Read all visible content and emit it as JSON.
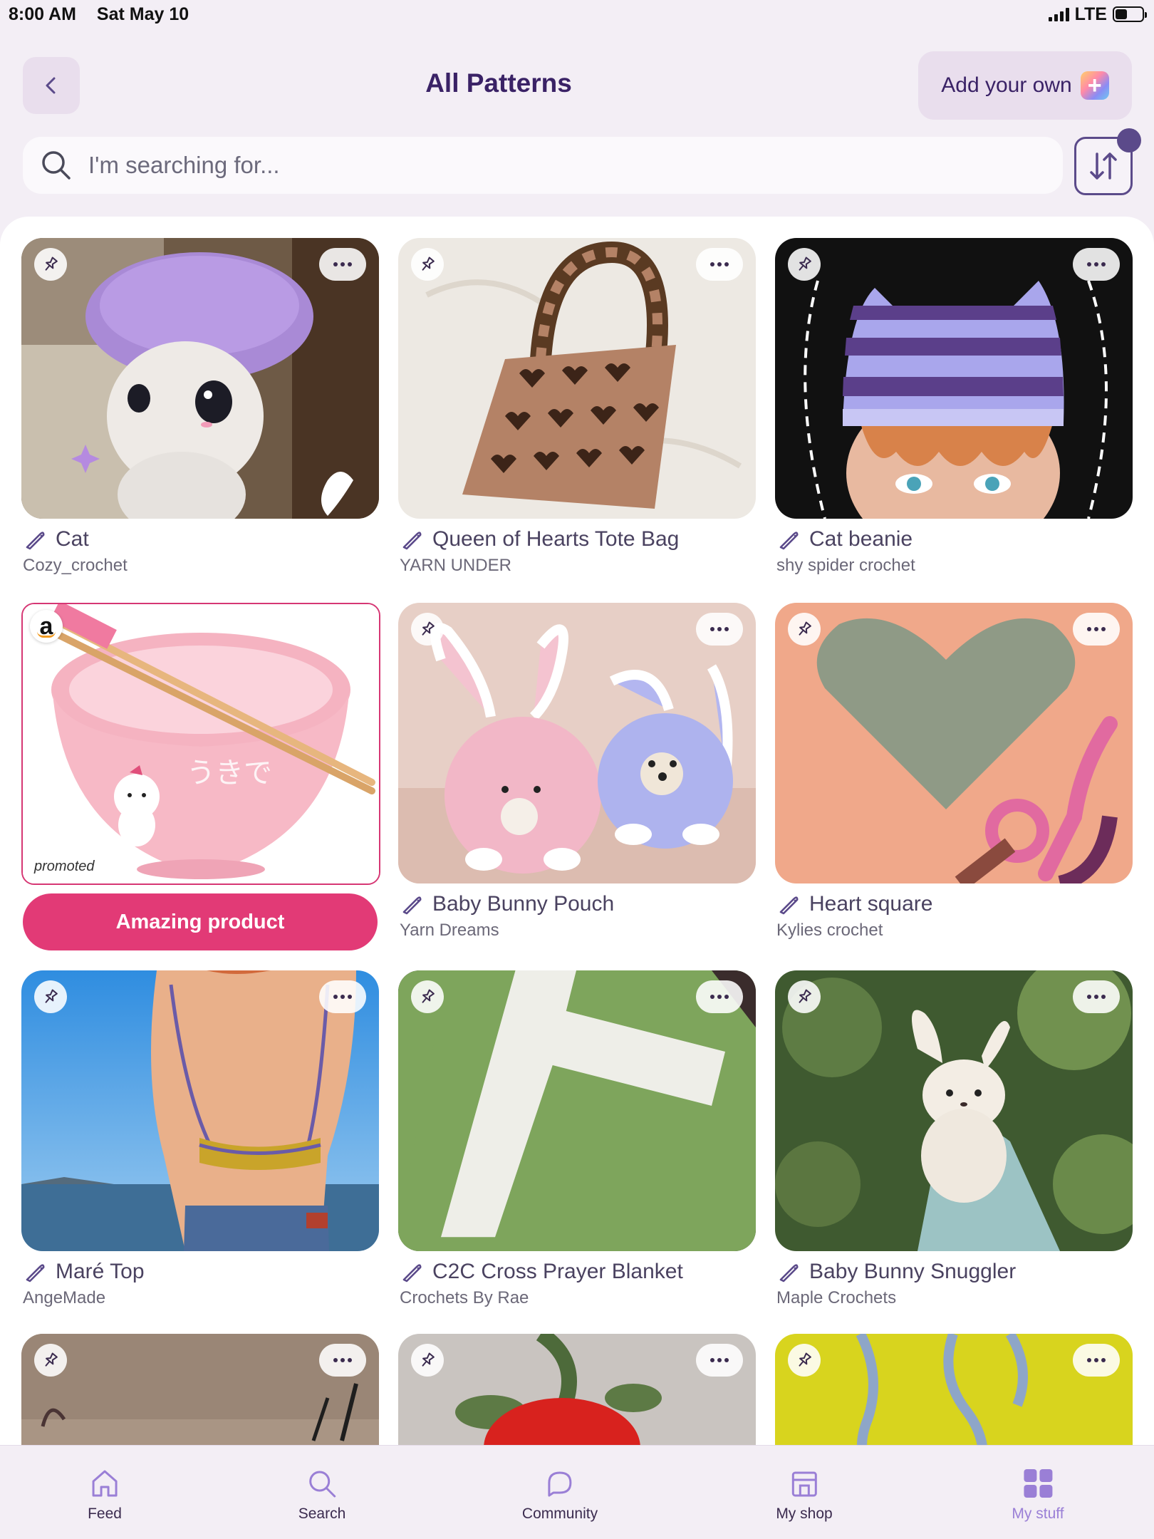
{
  "status_bar": {
    "time": "8:00 AM",
    "date": "Sat May 10",
    "network": "LTE"
  },
  "header": {
    "title": "All Patterns",
    "add_own_label": "Add your own"
  },
  "search": {
    "placeholder": "I'm searching for..."
  },
  "cards": [
    {
      "title": "Cat",
      "author": "Cozy_crochet"
    },
    {
      "title": "Queen of Hearts Tote Bag",
      "author": "YARN UNDER"
    },
    {
      "title": "Cat beanie",
      "author": "shy spider crochet"
    },
    {
      "title": "Baby Bunny Pouch",
      "author": "Yarn Dreams"
    },
    {
      "title": "Heart square",
      "author": "Kylies crochet"
    },
    {
      "title": "Maré Top",
      "author": "AngeMade"
    },
    {
      "title": "C2C Cross Prayer Blanket",
      "author": "Crochets By Rae"
    },
    {
      "title": "Baby Bunny Snuggler",
      "author": "Maple Crochets"
    }
  ],
  "promoted": {
    "logo": "a",
    "label": "promoted",
    "cta": "Amazing product"
  },
  "bottom_nav": [
    {
      "label": "Feed",
      "icon": "home-icon"
    },
    {
      "label": "Search",
      "icon": "search-icon"
    },
    {
      "label": "Community",
      "icon": "chat-bubble-icon"
    },
    {
      "label": "My shop",
      "icon": "shop-icon"
    },
    {
      "label": "My stuff",
      "icon": "grid-icon",
      "active": true
    }
  ],
  "colors": {
    "accent": "#3a2266",
    "promo_pink": "#e23a76",
    "active_nav": "#9a7fd6",
    "background": "#f3eef5"
  }
}
